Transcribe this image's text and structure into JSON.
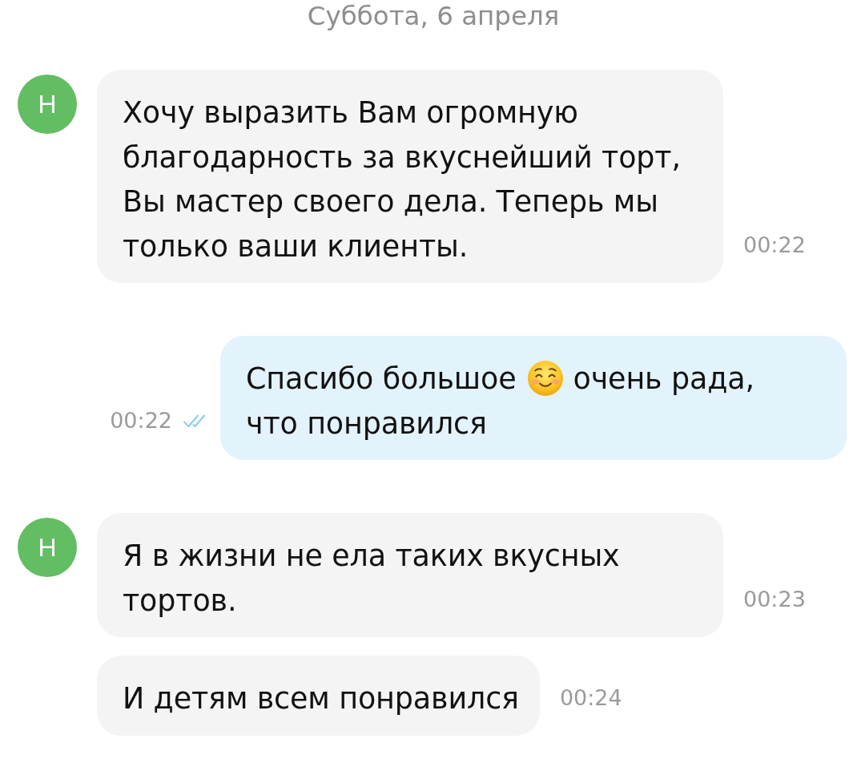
{
  "date_header": "Суббота, 6 апреля",
  "messages": [
    {
      "kind": "incoming",
      "avatar": "Н",
      "segments": [
        {
          "kind": "text",
          "text": "Хочу выразить Вам огромную благодарность за вкуснейший торт, Вы мастер своего дела. Теперь мы только ваши клиенты."
        }
      ],
      "time": "00:22"
    },
    {
      "kind": "outgoing",
      "segments": [
        {
          "kind": "text",
          "text": "Спасибо большое"
        },
        {
          "kind": "emoji"
        },
        {
          "kind": "text",
          "text": "очень рада, что понравился"
        }
      ],
      "time": "00:22",
      "read": true
    },
    {
      "kind": "incoming",
      "avatar": "Н",
      "segments": [
        {
          "kind": "text",
          "text": "Я в жизни не ела таких вкусных тортов."
        }
      ],
      "time": "00:23"
    },
    {
      "kind": "incoming",
      "segments": [
        {
          "kind": "text",
          "text": "И детям всем понравился"
        }
      ],
      "time": "00:24"
    }
  ]
}
